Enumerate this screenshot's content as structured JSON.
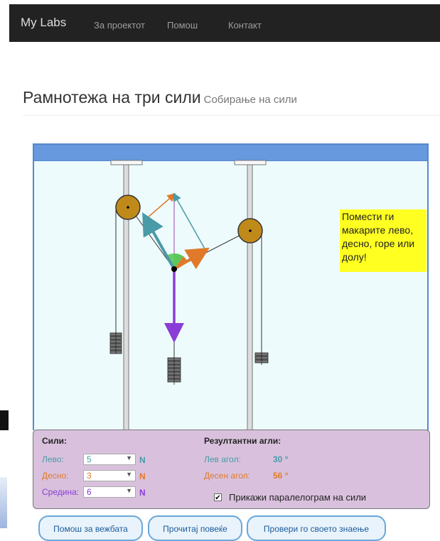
{
  "navbar": {
    "brand": "My Labs",
    "items": [
      "За проектот",
      "Помош",
      "Контакт"
    ]
  },
  "header": {
    "title": "Рамнотежа на три сили",
    "subtitle": "Собирање на сили"
  },
  "lab": {
    "tip": "Помести ги макарите лево, десно, горе или долу!"
  },
  "controls": {
    "forces_title": "Сили:",
    "left_label": "Лево:",
    "left_value": "5",
    "right_label": "Десно:",
    "right_value": "3",
    "middle_label": "Средина:",
    "middle_value": "6",
    "unit": "N",
    "angles_title": "Резултантни агли:",
    "left_angle_label": "Лев агол:",
    "left_angle_value": "30 °",
    "right_angle_label": "Десен агол:",
    "right_angle_value": "56 °",
    "checkbox_label": "Прикажи паралелограм на сили",
    "checkbox_checked": true
  },
  "buttons": {
    "help": "Помош за вежбата",
    "read_more": "Прочитај повеќе",
    "check": "Провери го своето знаење"
  },
  "colors": {
    "navbar": "#222222",
    "left_force": "#4a9aa8",
    "right_force": "#e07a2a",
    "middle_force": "#8a3dd6",
    "pulley": "#c08a1a",
    "panel": "#d9c1dd",
    "tip": "#ffff22"
  }
}
